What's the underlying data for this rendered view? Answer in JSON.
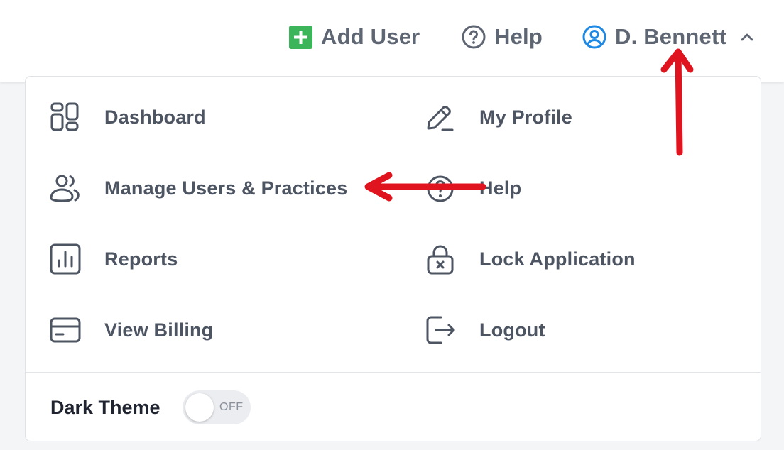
{
  "header": {
    "add_user_label": "Add User",
    "help_label": "Help",
    "user_name": "D. Bennett"
  },
  "menu": {
    "left": [
      {
        "label": "Dashboard",
        "icon": "dashboard-icon"
      },
      {
        "label": "Manage Users & Practices",
        "icon": "users-icon"
      },
      {
        "label": "Reports",
        "icon": "reports-icon"
      },
      {
        "label": "View Billing",
        "icon": "billing-card-icon"
      }
    ],
    "right": [
      {
        "label": "My Profile",
        "icon": "pencil-icon"
      },
      {
        "label": "Help",
        "icon": "help-icon"
      },
      {
        "label": "Lock Application",
        "icon": "lock-icon"
      },
      {
        "label": "Logout",
        "icon": "logout-icon"
      }
    ]
  },
  "theme": {
    "label": "Dark Theme",
    "toggle_state": "OFF"
  },
  "colors": {
    "accent_green": "#3cb45a",
    "user_blue": "#1e88e5",
    "annotation_red": "#e0141e",
    "text": "#4d5563"
  }
}
